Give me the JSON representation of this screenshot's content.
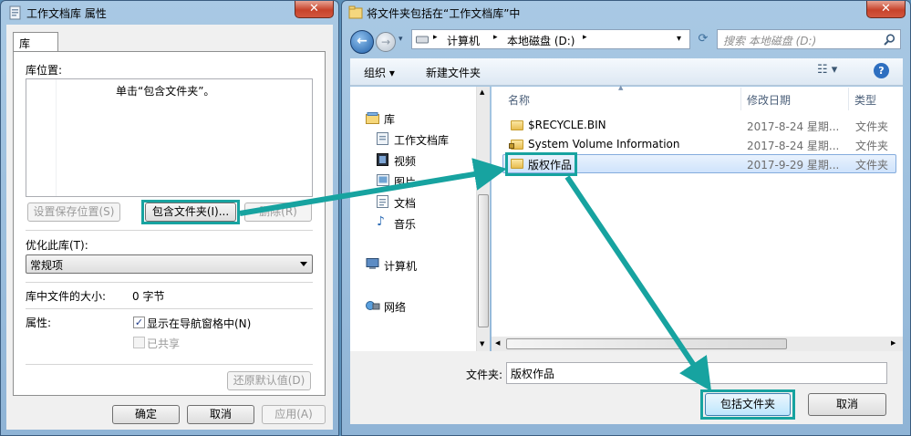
{
  "left_window": {
    "title": "工作文档库 属性",
    "close_glyph": "✕",
    "tab_label": "库",
    "library_locations_label": "库位置:",
    "listbox_hint": "单击“包含文件夹”。",
    "set_save_location_button": "设置保存位置(S)",
    "include_folder_button": "包含文件夹(I)...",
    "remove_button": "删除(R)",
    "optimize_label": "优化此库(T):",
    "optimize_value": "常规项",
    "size_label": "库中文件的大小:",
    "size_value": "0 字节",
    "attributes_label": "属性:",
    "show_in_nav_label": "显示在导航窗格中(N)",
    "show_in_nav_checked": "✓",
    "shared_label": "已共享",
    "restore_defaults_button": "还原默认值(D)",
    "ok_button": "确定",
    "cancel_button": "取消",
    "apply_button": "应用(A)"
  },
  "right_window": {
    "title": "将文件夹包括在“工作文档库”中",
    "close_glyph": "✕",
    "address": {
      "segments": [
        "计算机",
        "本地磁盘 (D:)"
      ],
      "separator": "▸"
    },
    "search_placeholder": "搜索 本地磁盘 (D:)",
    "toolbar": {
      "organize": "组织 ▾",
      "new_folder": "新建文件夹"
    },
    "nav": {
      "library": "库",
      "library_items": [
        "工作文档库",
        "视频",
        "图片",
        "文档",
        "音乐"
      ],
      "computer": "计算机",
      "network": "网络"
    },
    "columns": [
      "名称",
      "修改日期",
      "类型"
    ],
    "files": [
      {
        "name": "$RECYCLE.BIN",
        "date": "2017-8-24 星期...",
        "type": "文件夹"
      },
      {
        "name": "System Volume Information",
        "date": "2017-8-24 星期...",
        "type": "文件夹"
      },
      {
        "name": "版权作品",
        "date": "2017-9-29 星期...",
        "type": "文件夹"
      }
    ],
    "folder_label": "文件夹:",
    "folder_value": "版权作品",
    "include_folder_button": "包括文件夹",
    "cancel_button": "取消"
  },
  "colors": {
    "highlight": "#17a3a0",
    "titlebar": "#a9c9e4",
    "selection": "#cfe3fc"
  }
}
